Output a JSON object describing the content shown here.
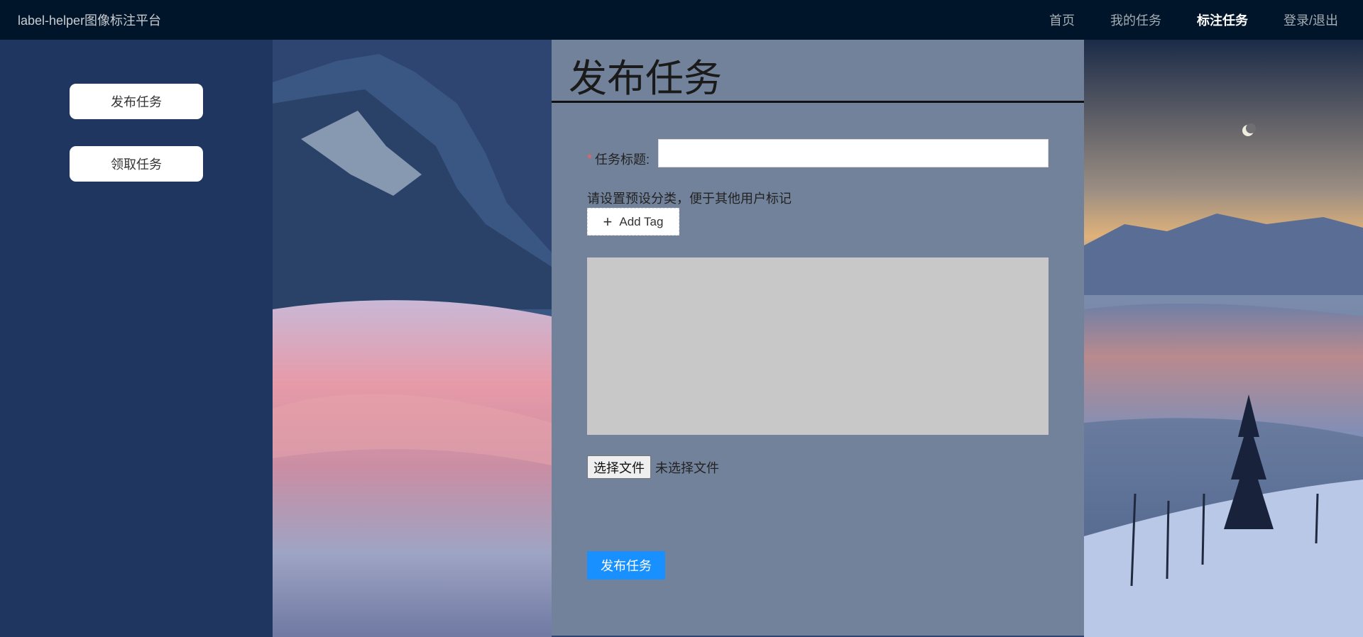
{
  "header": {
    "brand": "label-helper图像标注平台",
    "nav": [
      {
        "label": "首页",
        "active": false
      },
      {
        "label": "我的任务",
        "active": false
      },
      {
        "label": "标注任务",
        "active": true
      },
      {
        "label": "登录/退出",
        "active": false
      }
    ]
  },
  "sidebar": {
    "items": [
      {
        "label": "发布任务"
      },
      {
        "label": "领取任务"
      }
    ]
  },
  "form": {
    "title": "发布任务",
    "task_title_label": "任务标题:",
    "required_mark": "*",
    "task_title_value": "",
    "tag_hint": "请设置预设分类，便于其他用户标记",
    "add_tag_label": "Add Tag",
    "file_button_label": "选择文件",
    "file_status": "未选择文件",
    "submit_label": "发布任务"
  },
  "colors": {
    "header_bg": "#001529",
    "sidebar_bg": "#1f3661",
    "primary": "#1890ff",
    "required": "#f5605c"
  },
  "icons": {
    "add_tag": "plus-icon"
  }
}
